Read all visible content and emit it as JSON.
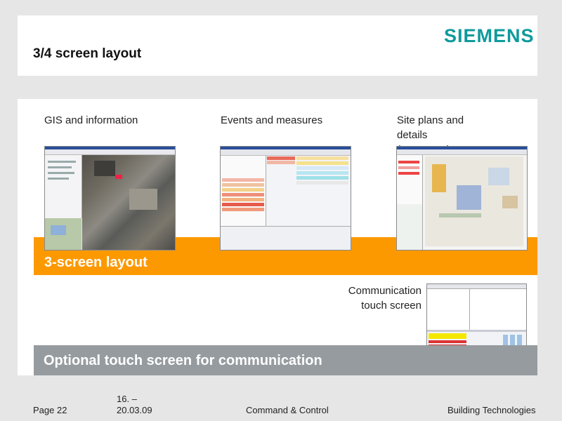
{
  "header": {
    "title": "3/4 screen layout",
    "logo": "SIEMENS"
  },
  "columns": [
    {
      "heading": "GIS and information"
    },
    {
      "heading": "Events and measures"
    },
    {
      "heading": "Site plans and details (resources)"
    }
  ],
  "banners": {
    "three_screen": "3-screen layout",
    "optional": "Optional touch screen for communication"
  },
  "communication_label": "Communication touch screen",
  "footer": {
    "page": "Page 22",
    "date_line1": "16. –",
    "date_line2": "20.03.09",
    "center": "Command & Control",
    "right": "Building Technologies"
  },
  "colors": {
    "brand": "#0e9a9d",
    "orange": "#fd9900",
    "gray_banner": "#969b9f"
  }
}
